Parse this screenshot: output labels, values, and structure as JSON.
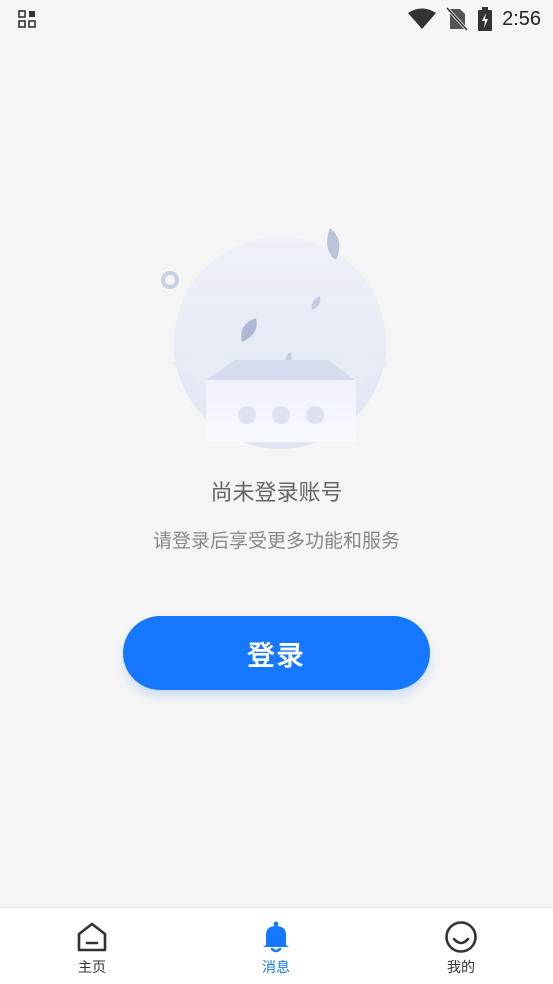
{
  "status_bar": {
    "time": "2:56",
    "icons": [
      "app-grid-icon",
      "wifi-icon",
      "no-sim-icon",
      "battery-charging-icon"
    ]
  },
  "empty_state": {
    "title": "尚未登录账号",
    "description": "请登录后享受更多功能和服务",
    "illustration": "empty-box-icon"
  },
  "login_button": {
    "label": "登录"
  },
  "tab_bar": {
    "tabs": [
      {
        "label": "主页",
        "icon": "home-icon",
        "active": false
      },
      {
        "label": "消息",
        "icon": "bell-icon",
        "active": true
      },
      {
        "label": "我的",
        "icon": "smile-icon",
        "active": false
      }
    ]
  },
  "colors": {
    "accent": "#1677ff",
    "background": "#f5f5f5",
    "text_primary": "#666666",
    "text_secondary": "#888888"
  }
}
